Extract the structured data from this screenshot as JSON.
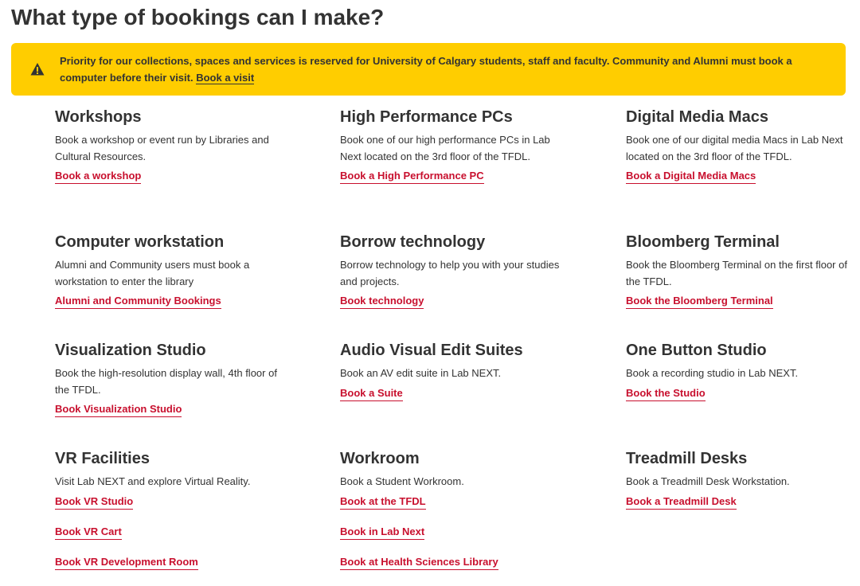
{
  "page": {
    "title": "What type of bookings can I make?"
  },
  "alert": {
    "icon": "warning-icon",
    "text": "Priority for our collections, spaces and services is reserved for University of Calgary students, staff and faculty. Community and Alumni must book a computer before their visit.",
    "link_label": "Book a visit",
    "background_color": "#ffcd00"
  },
  "colors": {
    "link": "#c8102e",
    "text": "#333333"
  },
  "cards": [
    {
      "title": "Workshops",
      "description": "Book a workshop or event run by Libraries and Cultural Resources.",
      "links": [
        "Book a workshop"
      ]
    },
    {
      "title": "High Performance PCs",
      "description": "Book one of our high performance PCs in Lab Next located on the 3rd floor of the TFDL.",
      "links": [
        "Book a High Performance PC"
      ]
    },
    {
      "title": "Digital Media Macs",
      "description": "Book one of our digital media Macs in Lab Next located on the 3rd floor of the TFDL.",
      "links": [
        "Book a Digital Media Macs"
      ]
    },
    {
      "title": "Computer workstation",
      "description": "Alumni and Community users must book a workstation to enter the library",
      "links": [
        "Alumni and Community Bookings"
      ]
    },
    {
      "title": "Borrow technology",
      "description": "Borrow technology to help you with your studies and projects.",
      "links": [
        "Book technology"
      ]
    },
    {
      "title": "Bloomberg Terminal",
      "description": "Book the Bloomberg Terminal on the first floor of the TFDL.",
      "links": [
        "Book the Bloomberg Terminal"
      ]
    },
    {
      "title": "Visualization Studio",
      "description": "Book the high-resolution display wall, 4th floor of the TFDL.",
      "links": [
        "Book Visualization Studio"
      ]
    },
    {
      "title": "Audio Visual Edit Suites",
      "description": "Book an AV edit suite in Lab NEXT.",
      "links": [
        "Book a Suite"
      ]
    },
    {
      "title": "One Button Studio",
      "description": "Book a recording studio in Lab NEXT.",
      "links": [
        "Book the Studio"
      ]
    },
    {
      "title": "VR Facilities",
      "description": "Visit Lab NEXT and explore Virtual Reality.",
      "links": [
        "Book VR Studio",
        "Book VR Cart",
        "Book VR Development Room"
      ]
    },
    {
      "title": "Workroom",
      "description": "Book a Student Workroom.",
      "links": [
        "Book at the TFDL",
        "Book in Lab Next",
        "Book at Health Sciences Library"
      ]
    },
    {
      "title": "Treadmill Desks",
      "description": "Book a Treadmill Desk Workstation.",
      "links": [
        "Book a Treadmill Desk"
      ]
    }
  ]
}
